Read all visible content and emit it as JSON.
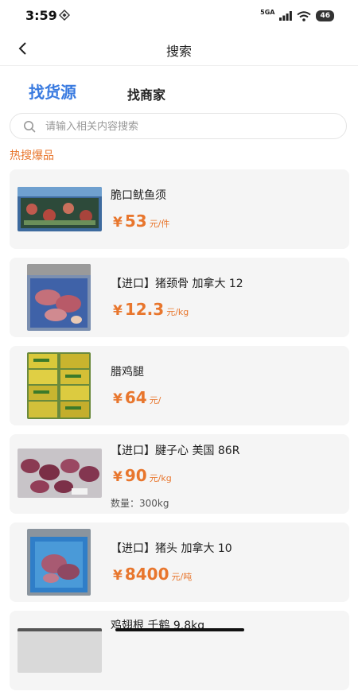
{
  "status": {
    "time": "3:59",
    "network": "5GA",
    "battery": "46"
  },
  "nav": {
    "title": "搜索"
  },
  "tabs": [
    {
      "label": "找货源",
      "active": true
    },
    {
      "label": "找商家",
      "active": false
    }
  ],
  "search": {
    "placeholder": "请输入相关内容搜索",
    "value": ""
  },
  "section": {
    "title": "热搜爆品"
  },
  "products": [
    {
      "name": "脆口鱿鱼须",
      "currency": "¥",
      "price": "53",
      "unit": "元/件",
      "quantity": ""
    },
    {
      "name": "【进口】猪颈骨 加拿大 12",
      "currency": "¥",
      "price": "12.3",
      "unit": "元/kg",
      "quantity": ""
    },
    {
      "name": "腊鸡腿",
      "currency": "¥",
      "price": "64",
      "unit": "元/",
      "quantity": ""
    },
    {
      "name": "【进口】腱子心 美国 86R",
      "currency": "¥",
      "price": "90",
      "unit": "元/kg",
      "quantity": "数量：300kg"
    },
    {
      "name": "【进口】猪头 加拿大 10",
      "currency": "¥",
      "price": "8400",
      "unit": "元/吨",
      "quantity": ""
    },
    {
      "name": "鸡翅根 千鹤 9.8kg",
      "currency": "",
      "price": "",
      "unit": "",
      "quantity": ""
    }
  ],
  "colors": {
    "accent": "#e8762d",
    "tab_active": "#3a7be0",
    "card_bg": "#f5f5f5"
  }
}
